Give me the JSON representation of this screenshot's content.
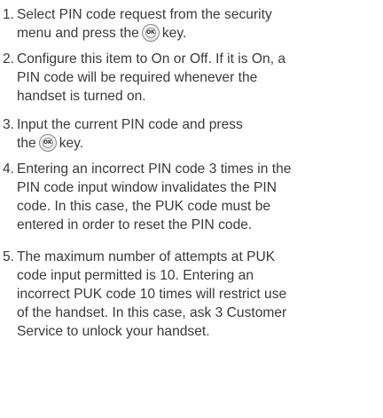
{
  "ok_key": {
    "icon": "ok-key-icon",
    "label": "OK"
  },
  "steps": [
    {
      "number": "1.",
      "lines": [
        "Select PIN code request from the security",
        "menu and press the",
        "key."
      ]
    },
    {
      "number": "2.",
      "lines": [
        "Configure this item to On or Off. If it is On, a",
        "PIN code will be required whenever the",
        "handset is turned on."
      ]
    },
    {
      "number": "3.",
      "lines": [
        "Input the current PIN code and press",
        "the",
        "key."
      ]
    },
    {
      "number": "4.",
      "lines": [
        "Entering an incorrect PIN code 3 times in the",
        "PIN code input window invalidates the PIN",
        "code. In this case, the PUK code must be",
        "entered in order to reset the PIN code."
      ]
    },
    {
      "number": "5.",
      "lines": [
        "The maximum number of attempts at PUK",
        "code input permitted is 10. Entering an",
        "incorrect PUK code 10 times will restrict use",
        "of the handset. In this case, ask 3 Customer",
        "Service to unlock your handset."
      ]
    }
  ]
}
